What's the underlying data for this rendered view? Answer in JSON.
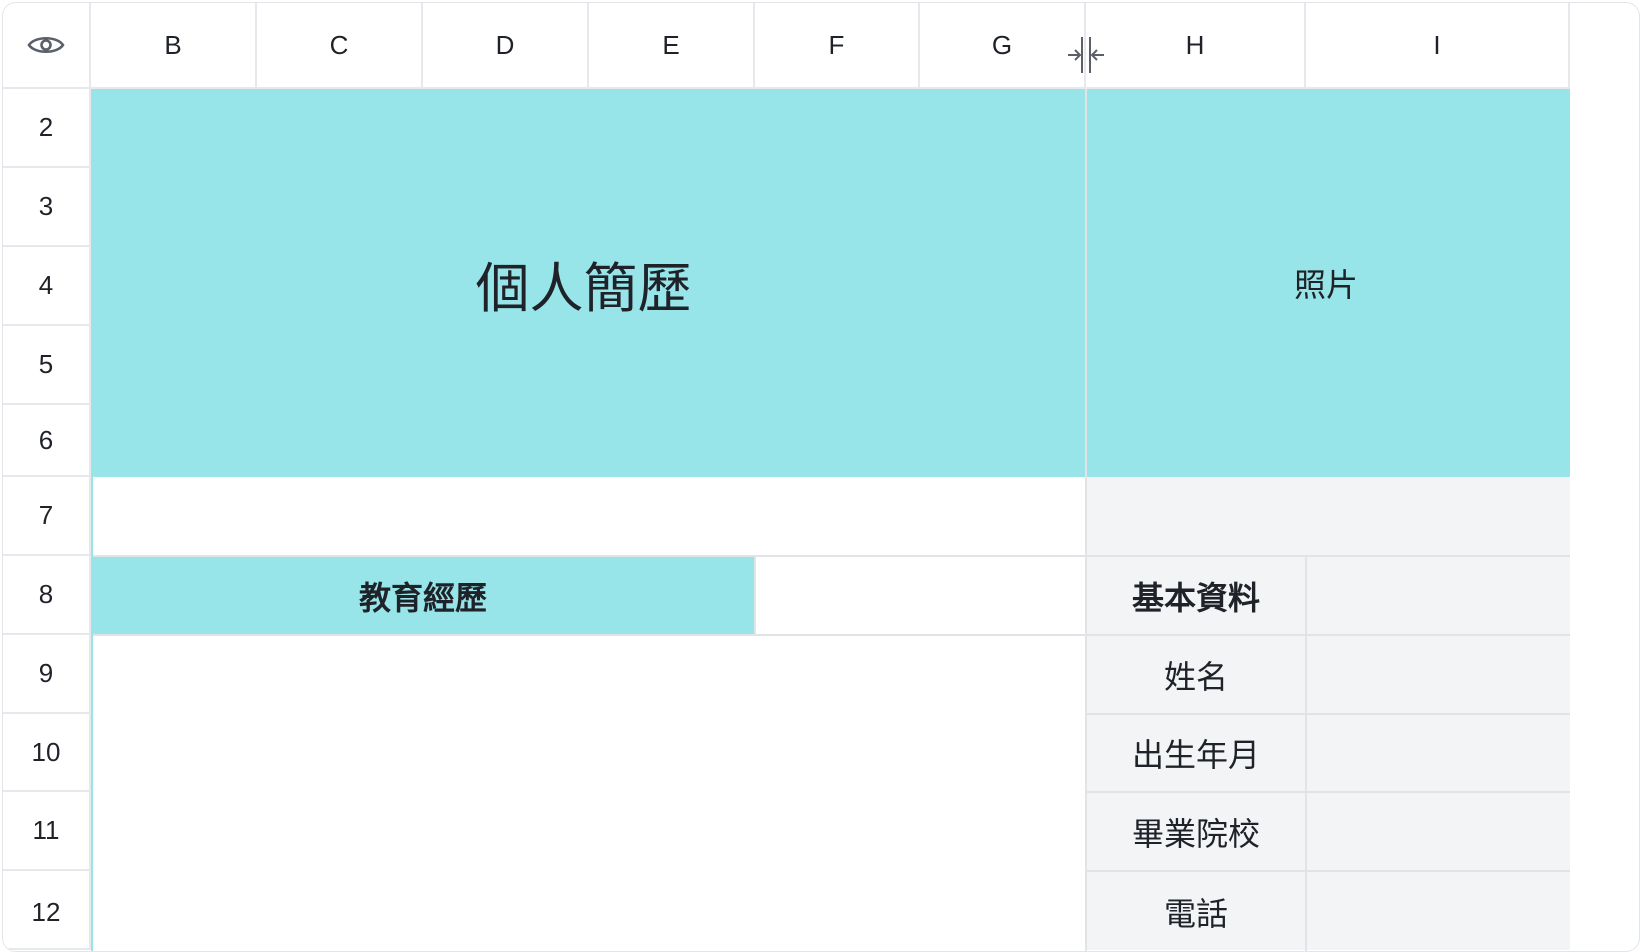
{
  "header": {
    "visibility_icon": "eye-icon",
    "columns": [
      "B",
      "C",
      "D",
      "E",
      "F",
      "G",
      "H",
      "I"
    ],
    "freeze_icon": "column-resize-icon"
  },
  "rows": [
    "2",
    "3",
    "4",
    "5",
    "6",
    "7",
    "8",
    "9",
    "10",
    "11",
    "12"
  ],
  "cells": {
    "title": "個人簡歷",
    "photo": "照片",
    "education": "教育經歷",
    "basic_info": "基本資料",
    "name_label": "姓名",
    "birth_label": "出生年月",
    "school_label": "畢業院校",
    "phone_label": "電話"
  },
  "colors": {
    "teal_fill": "#97e5e8",
    "grey_fill": "#f3f4f6",
    "grid_line": "#e1e3e6"
  }
}
